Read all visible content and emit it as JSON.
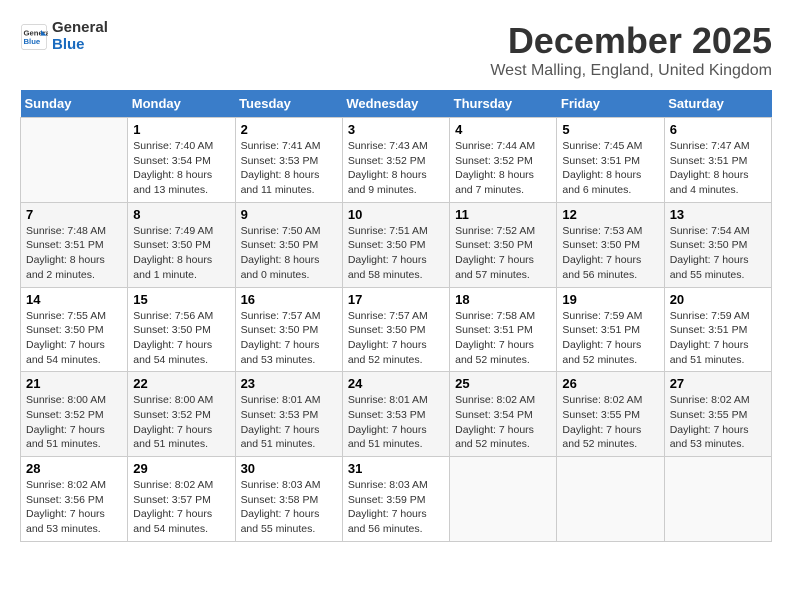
{
  "header": {
    "logo_line1": "General",
    "logo_line2": "Blue",
    "month": "December 2025",
    "location": "West Malling, England, United Kingdom"
  },
  "weekdays": [
    "Sunday",
    "Monday",
    "Tuesday",
    "Wednesday",
    "Thursday",
    "Friday",
    "Saturday"
  ],
  "weeks": [
    [
      {
        "day": "",
        "sunrise": "",
        "sunset": "",
        "daylight": ""
      },
      {
        "day": "1",
        "sunrise": "Sunrise: 7:40 AM",
        "sunset": "Sunset: 3:54 PM",
        "daylight": "Daylight: 8 hours and 13 minutes."
      },
      {
        "day": "2",
        "sunrise": "Sunrise: 7:41 AM",
        "sunset": "Sunset: 3:53 PM",
        "daylight": "Daylight: 8 hours and 11 minutes."
      },
      {
        "day": "3",
        "sunrise": "Sunrise: 7:43 AM",
        "sunset": "Sunset: 3:52 PM",
        "daylight": "Daylight: 8 hours and 9 minutes."
      },
      {
        "day": "4",
        "sunrise": "Sunrise: 7:44 AM",
        "sunset": "Sunset: 3:52 PM",
        "daylight": "Daylight: 8 hours and 7 minutes."
      },
      {
        "day": "5",
        "sunrise": "Sunrise: 7:45 AM",
        "sunset": "Sunset: 3:51 PM",
        "daylight": "Daylight: 8 hours and 6 minutes."
      },
      {
        "day": "6",
        "sunrise": "Sunrise: 7:47 AM",
        "sunset": "Sunset: 3:51 PM",
        "daylight": "Daylight: 8 hours and 4 minutes."
      }
    ],
    [
      {
        "day": "7",
        "sunrise": "Sunrise: 7:48 AM",
        "sunset": "Sunset: 3:51 PM",
        "daylight": "Daylight: 8 hours and 2 minutes."
      },
      {
        "day": "8",
        "sunrise": "Sunrise: 7:49 AM",
        "sunset": "Sunset: 3:50 PM",
        "daylight": "Daylight: 8 hours and 1 minute."
      },
      {
        "day": "9",
        "sunrise": "Sunrise: 7:50 AM",
        "sunset": "Sunset: 3:50 PM",
        "daylight": "Daylight: 8 hours and 0 minutes."
      },
      {
        "day": "10",
        "sunrise": "Sunrise: 7:51 AM",
        "sunset": "Sunset: 3:50 PM",
        "daylight": "Daylight: 7 hours and 58 minutes."
      },
      {
        "day": "11",
        "sunrise": "Sunrise: 7:52 AM",
        "sunset": "Sunset: 3:50 PM",
        "daylight": "Daylight: 7 hours and 57 minutes."
      },
      {
        "day": "12",
        "sunrise": "Sunrise: 7:53 AM",
        "sunset": "Sunset: 3:50 PM",
        "daylight": "Daylight: 7 hours and 56 minutes."
      },
      {
        "day": "13",
        "sunrise": "Sunrise: 7:54 AM",
        "sunset": "Sunset: 3:50 PM",
        "daylight": "Daylight: 7 hours and 55 minutes."
      }
    ],
    [
      {
        "day": "14",
        "sunrise": "Sunrise: 7:55 AM",
        "sunset": "Sunset: 3:50 PM",
        "daylight": "Daylight: 7 hours and 54 minutes."
      },
      {
        "day": "15",
        "sunrise": "Sunrise: 7:56 AM",
        "sunset": "Sunset: 3:50 PM",
        "daylight": "Daylight: 7 hours and 54 minutes."
      },
      {
        "day": "16",
        "sunrise": "Sunrise: 7:57 AM",
        "sunset": "Sunset: 3:50 PM",
        "daylight": "Daylight: 7 hours and 53 minutes."
      },
      {
        "day": "17",
        "sunrise": "Sunrise: 7:57 AM",
        "sunset": "Sunset: 3:50 PM",
        "daylight": "Daylight: 7 hours and 52 minutes."
      },
      {
        "day": "18",
        "sunrise": "Sunrise: 7:58 AM",
        "sunset": "Sunset: 3:51 PM",
        "daylight": "Daylight: 7 hours and 52 minutes."
      },
      {
        "day": "19",
        "sunrise": "Sunrise: 7:59 AM",
        "sunset": "Sunset: 3:51 PM",
        "daylight": "Daylight: 7 hours and 52 minutes."
      },
      {
        "day": "20",
        "sunrise": "Sunrise: 7:59 AM",
        "sunset": "Sunset: 3:51 PM",
        "daylight": "Daylight: 7 hours and 51 minutes."
      }
    ],
    [
      {
        "day": "21",
        "sunrise": "Sunrise: 8:00 AM",
        "sunset": "Sunset: 3:52 PM",
        "daylight": "Daylight: 7 hours and 51 minutes."
      },
      {
        "day": "22",
        "sunrise": "Sunrise: 8:00 AM",
        "sunset": "Sunset: 3:52 PM",
        "daylight": "Daylight: 7 hours and 51 minutes."
      },
      {
        "day": "23",
        "sunrise": "Sunrise: 8:01 AM",
        "sunset": "Sunset: 3:53 PM",
        "daylight": "Daylight: 7 hours and 51 minutes."
      },
      {
        "day": "24",
        "sunrise": "Sunrise: 8:01 AM",
        "sunset": "Sunset: 3:53 PM",
        "daylight": "Daylight: 7 hours and 51 minutes."
      },
      {
        "day": "25",
        "sunrise": "Sunrise: 8:02 AM",
        "sunset": "Sunset: 3:54 PM",
        "daylight": "Daylight: 7 hours and 52 minutes."
      },
      {
        "day": "26",
        "sunrise": "Sunrise: 8:02 AM",
        "sunset": "Sunset: 3:55 PM",
        "daylight": "Daylight: 7 hours and 52 minutes."
      },
      {
        "day": "27",
        "sunrise": "Sunrise: 8:02 AM",
        "sunset": "Sunset: 3:55 PM",
        "daylight": "Daylight: 7 hours and 53 minutes."
      }
    ],
    [
      {
        "day": "28",
        "sunrise": "Sunrise: 8:02 AM",
        "sunset": "Sunset: 3:56 PM",
        "daylight": "Daylight: 7 hours and 53 minutes."
      },
      {
        "day": "29",
        "sunrise": "Sunrise: 8:02 AM",
        "sunset": "Sunset: 3:57 PM",
        "daylight": "Daylight: 7 hours and 54 minutes."
      },
      {
        "day": "30",
        "sunrise": "Sunrise: 8:03 AM",
        "sunset": "Sunset: 3:58 PM",
        "daylight": "Daylight: 7 hours and 55 minutes."
      },
      {
        "day": "31",
        "sunrise": "Sunrise: 8:03 AM",
        "sunset": "Sunset: 3:59 PM",
        "daylight": "Daylight: 7 hours and 56 minutes."
      },
      {
        "day": "",
        "sunrise": "",
        "sunset": "",
        "daylight": ""
      },
      {
        "day": "",
        "sunrise": "",
        "sunset": "",
        "daylight": ""
      },
      {
        "day": "",
        "sunrise": "",
        "sunset": "",
        "daylight": ""
      }
    ]
  ]
}
